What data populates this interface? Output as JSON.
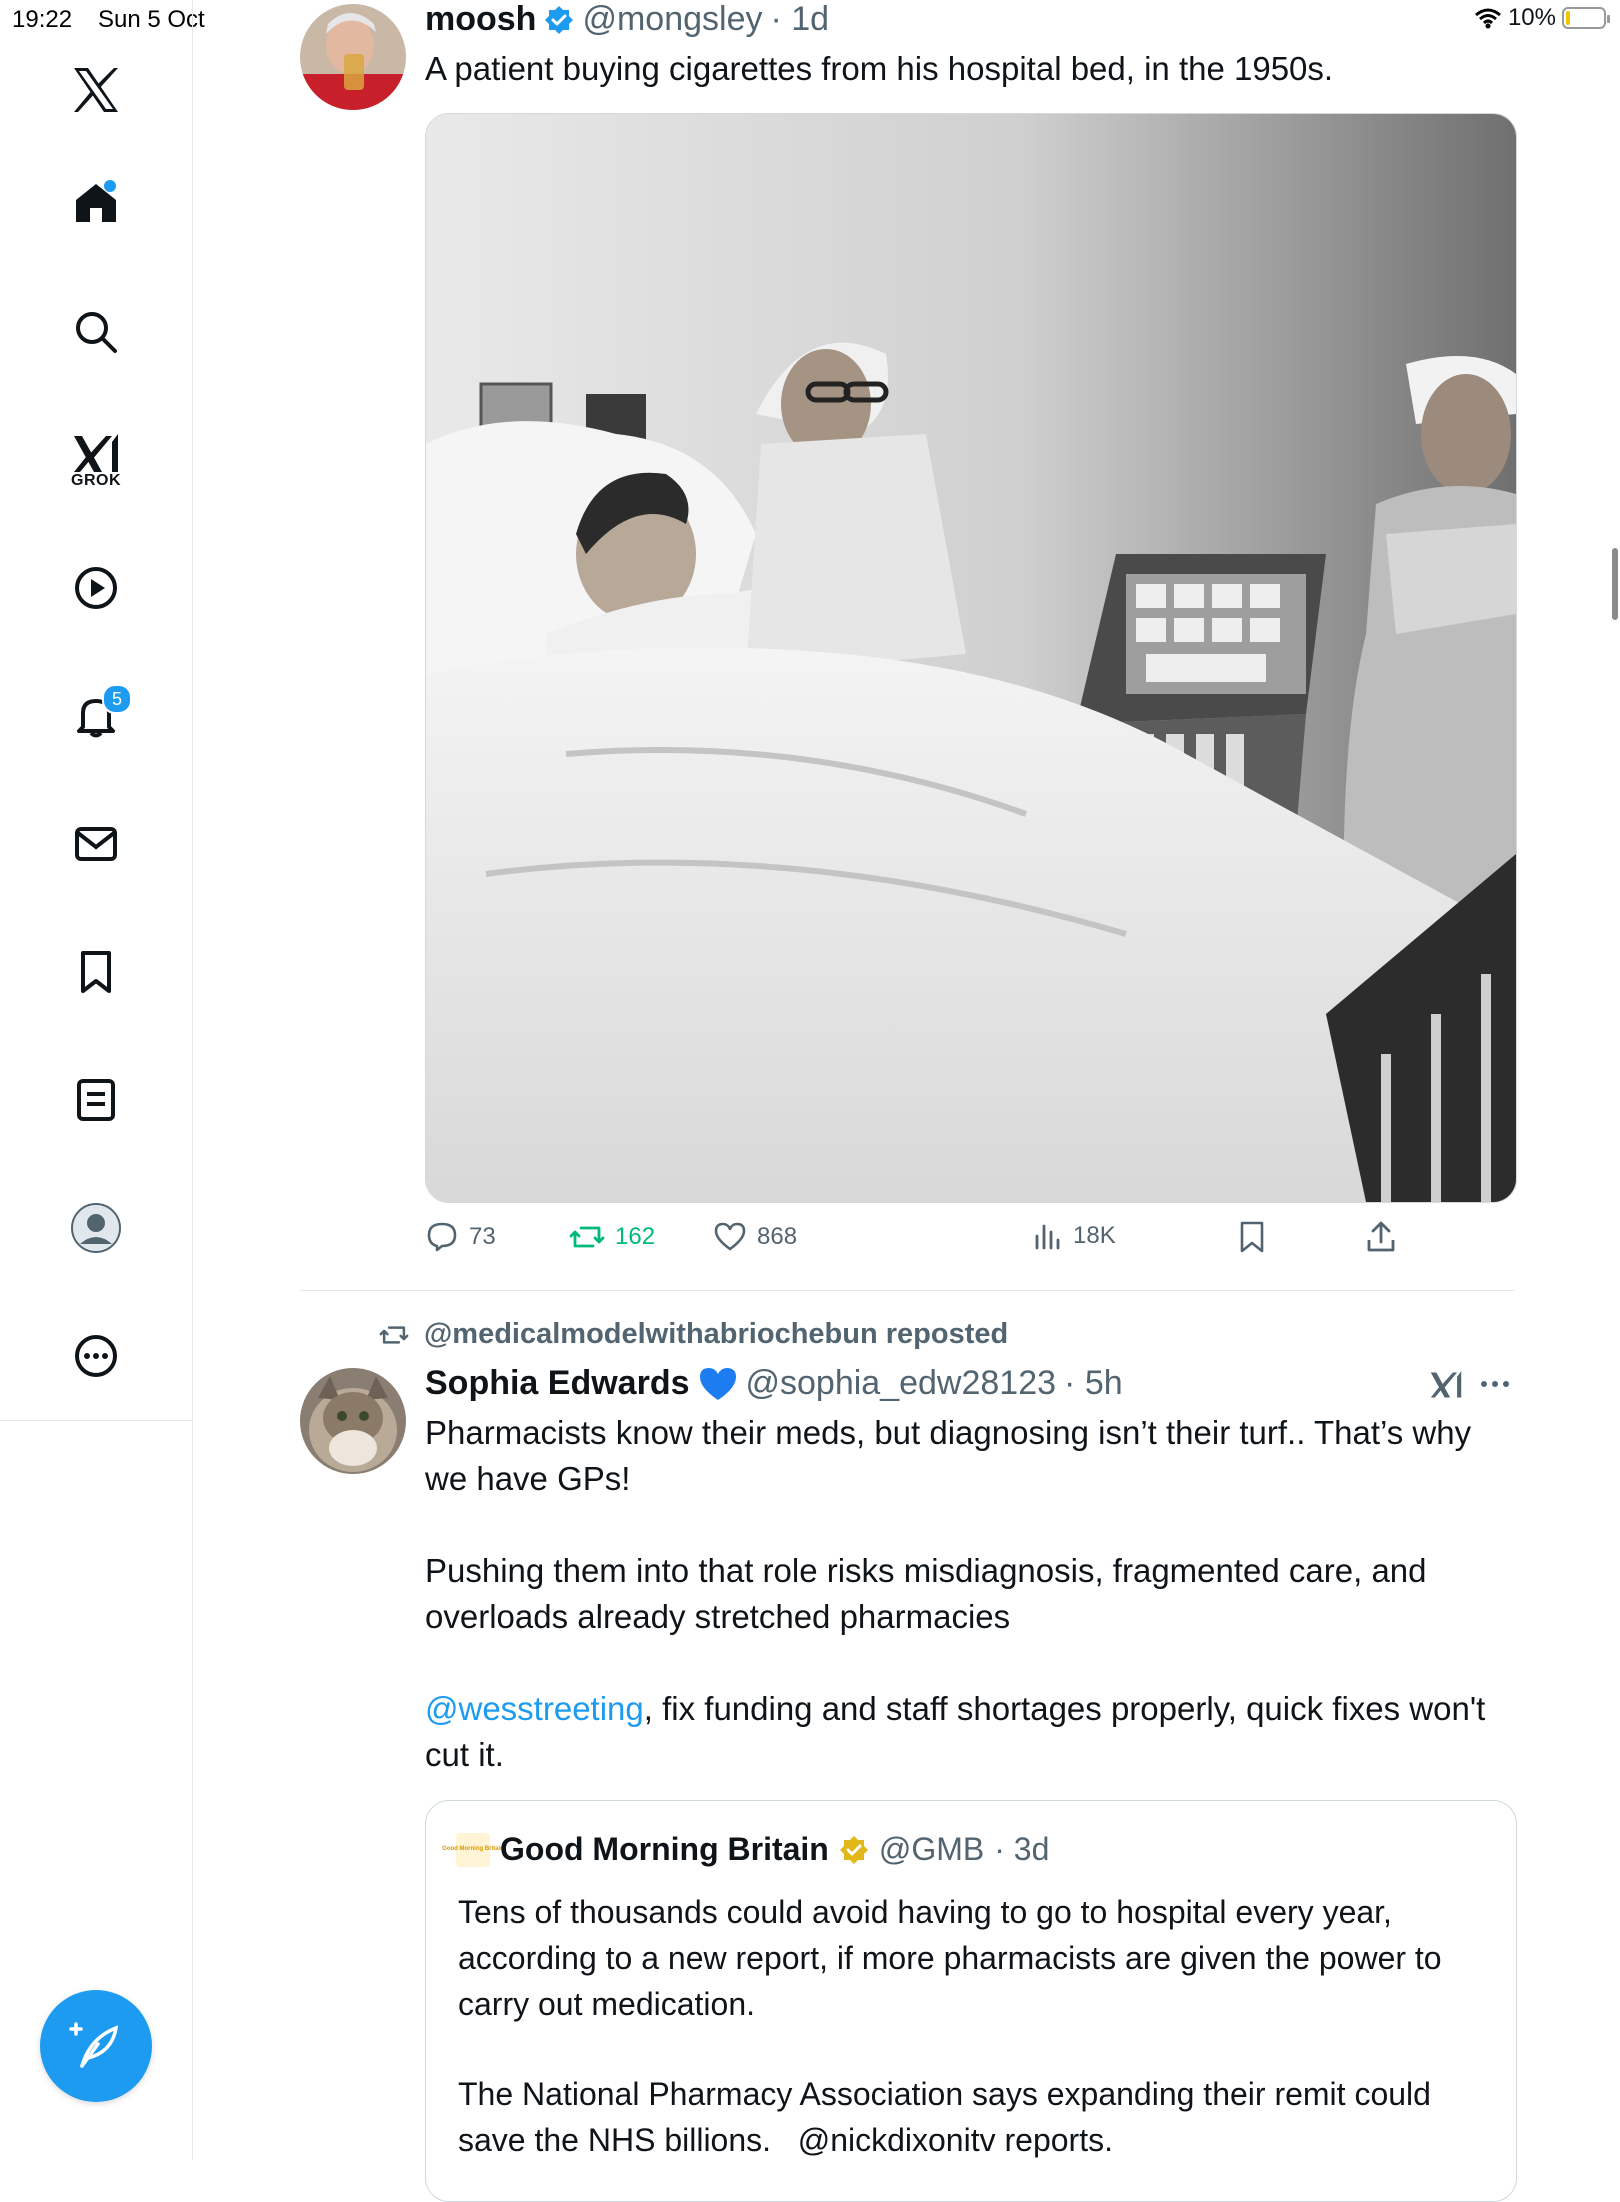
{
  "status_bar": {
    "time": "19:22",
    "date": "Sun 5 Oct",
    "battery": "10%",
    "battery_level": 0.1
  },
  "sidebar": {
    "grok_label": "GROK",
    "notifications_count": "5"
  },
  "tweet1": {
    "display_name": "moosh",
    "handle": "@mongsley",
    "time": "· 1d",
    "text": "A patient buying cigarettes from his hospital bed, in the 1950s.",
    "replies": "73",
    "reposts": "162",
    "likes": "868",
    "views": "18K"
  },
  "tweet2": {
    "reposted_by": "@medicalmodelwithabriochebun reposted",
    "display_name": "Sophia Edwards",
    "handle": "@sophia_edw28123",
    "time": "· 5h",
    "para1": "Pharmacists know their meds, but diagnosing isn’t their turf.. That’s why we have GPs!",
    "para2": "Pushing them into that role risks misdiagnosis, fragmented care, and overloads already stretched pharmacies",
    "mention": "@wesstreeting",
    "para3_rest": ", fix funding and staff shortages properly, quick fixes won't cut it.",
    "quote": {
      "display_name": "Good Morning Britain",
      "handle": "@GMB",
      "time": "· 3d",
      "logo_text": "Good Morning Britain",
      "para1": "Tens of thousands could avoid having to go to hospital every year, according to a new report, if more pharmacists are given the power to carry out medication.",
      "para2": "The National Pharmacy Association says expanding their remit could save the NHS billions.",
      "para2_mention": "@nickdixonitv",
      "para2_tail": " reports."
    }
  },
  "colors": {
    "accent": "#1d9bf0",
    "repost_green": "#00ba7c",
    "secondary_text": "#536471",
    "verified_gold": "#e2b719"
  }
}
